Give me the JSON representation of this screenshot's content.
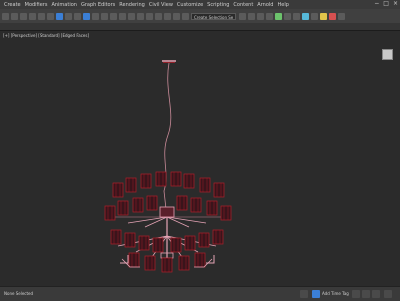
{
  "menu": {
    "items": [
      "Create",
      "Modifiers",
      "Animation",
      "Graph Editors",
      "Rendering",
      "Civil View",
      "Customize",
      "Scripting",
      "Content",
      "Arnold",
      "Help"
    ],
    "window_controls": [
      "−",
      "□",
      "×"
    ]
  },
  "toolbar": {
    "selection_dropdown": "Create Selection Se"
  },
  "viewport": {
    "label": "[+] [Perspective] [Standard] [Edged Faces]"
  },
  "status": {
    "selection": "None Selected",
    "add_time_tag": "Add Time Tag"
  },
  "colors": {
    "accent": "#3b7fd6",
    "wire_red": "#b0202a",
    "wire_pink": "#e6a4b6"
  }
}
